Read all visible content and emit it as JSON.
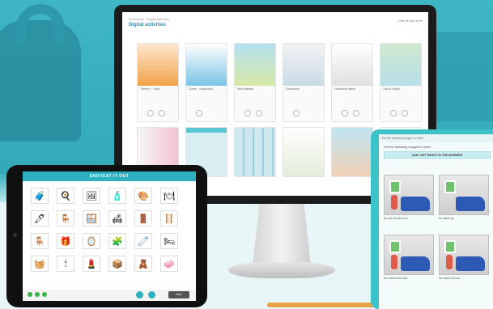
{
  "monitor": {
    "breadcrumb": "Resources › Digital activities",
    "title": "Digital activities",
    "controls": "Filter ▾   Sort by ▾",
    "cards_row1": [
      {
        "caption": "Theme 1 · topic",
        "color": "#f0a24a"
      },
      {
        "caption": "Comic · vocabulary",
        "color": "#7ac4e6"
      },
      {
        "caption": "Wild animals",
        "color": "#d6e9a8"
      },
      {
        "caption": "Classroom",
        "color": "#c9dce6"
      },
      {
        "caption": "Household items",
        "color": "#e0e0e0"
      },
      {
        "caption": "Toys & things",
        "color": "#b7dfe8"
      }
    ],
    "cards_row2": [
      {
        "color": "#f2c1d1"
      },
      {
        "color": "#d9eef2"
      },
      {
        "color": "#cfe8f0"
      },
      {
        "color": "#e4ecd9"
      },
      {
        "color": "#f1d0b6"
      },
      {
        "color": "#fafafa"
      }
    ]
  },
  "tablet_left": {
    "header": "ENOVEAT IT OUT",
    "icons": [
      "🧳",
      "🍳",
      "🖼",
      "🧴",
      "🎨",
      "🍽",
      "🖊",
      "🪑",
      "🪟",
      "🛋",
      "🚪",
      "🪜",
      "🪑",
      "🎁",
      "🪞",
      "🧩",
      "🧷",
      "🛏",
      "🧺",
      "🕯",
      "💄",
      "📦",
      "🧸",
      "🧼"
    ],
    "footer_button": "Next"
  },
  "tablet_right": {
    "topbar": "Put the following images in order",
    "instruction": "Put the following images in order.",
    "title": "CAN I GET READY IN THE MORNING",
    "captions": [
      "He puts his shoes on.",
      "He wakes up.",
      "He brushes his teeth.",
      "He makes his bed."
    ]
  }
}
